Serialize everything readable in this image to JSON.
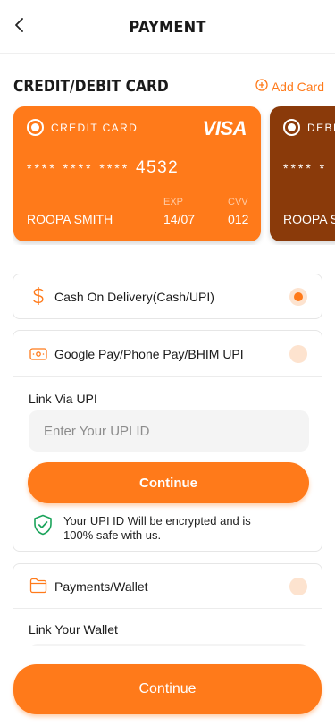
{
  "header": {
    "title": "PAYMENT"
  },
  "section": {
    "title": "CREDIT/DEBIT CARD",
    "add_card_label": "Add Card"
  },
  "cards": [
    {
      "type_label": "CREDIT CARD",
      "brand": "VISA",
      "masked": "**** **** ****",
      "last4": "4532",
      "holder": "ROOPA SMITH",
      "exp_label": "EXP",
      "exp": "14/07",
      "cvv_label": "CVV",
      "cvv": "012",
      "selected": true
    },
    {
      "type_label": "DEBI",
      "masked": "**** *",
      "holder": "ROOPA S",
      "selected": false
    }
  ],
  "options": {
    "cod": {
      "label": "Cash On Delivery(Cash/UPI)",
      "selected": true
    },
    "upi": {
      "label": "Google Pay/Phone Pay/BHIM UPI",
      "selected": false,
      "link_label": "Link Via UPI",
      "input_placeholder": "Enter Your UPI ID",
      "continue_label": "Continue",
      "secure_text": "Your UPI ID Will be encrypted and is 100% safe with us."
    },
    "wallet": {
      "label": "Payments/Wallet",
      "selected": false,
      "link_label": "Link Your Wallet"
    }
  },
  "footer": {
    "continue_label": "Continue"
  },
  "colors": {
    "accent": "#ff7a1a",
    "accent_light": "#fde3cf",
    "debit_card": "#8a3a0a",
    "secure_icon": "#1aa35a"
  }
}
